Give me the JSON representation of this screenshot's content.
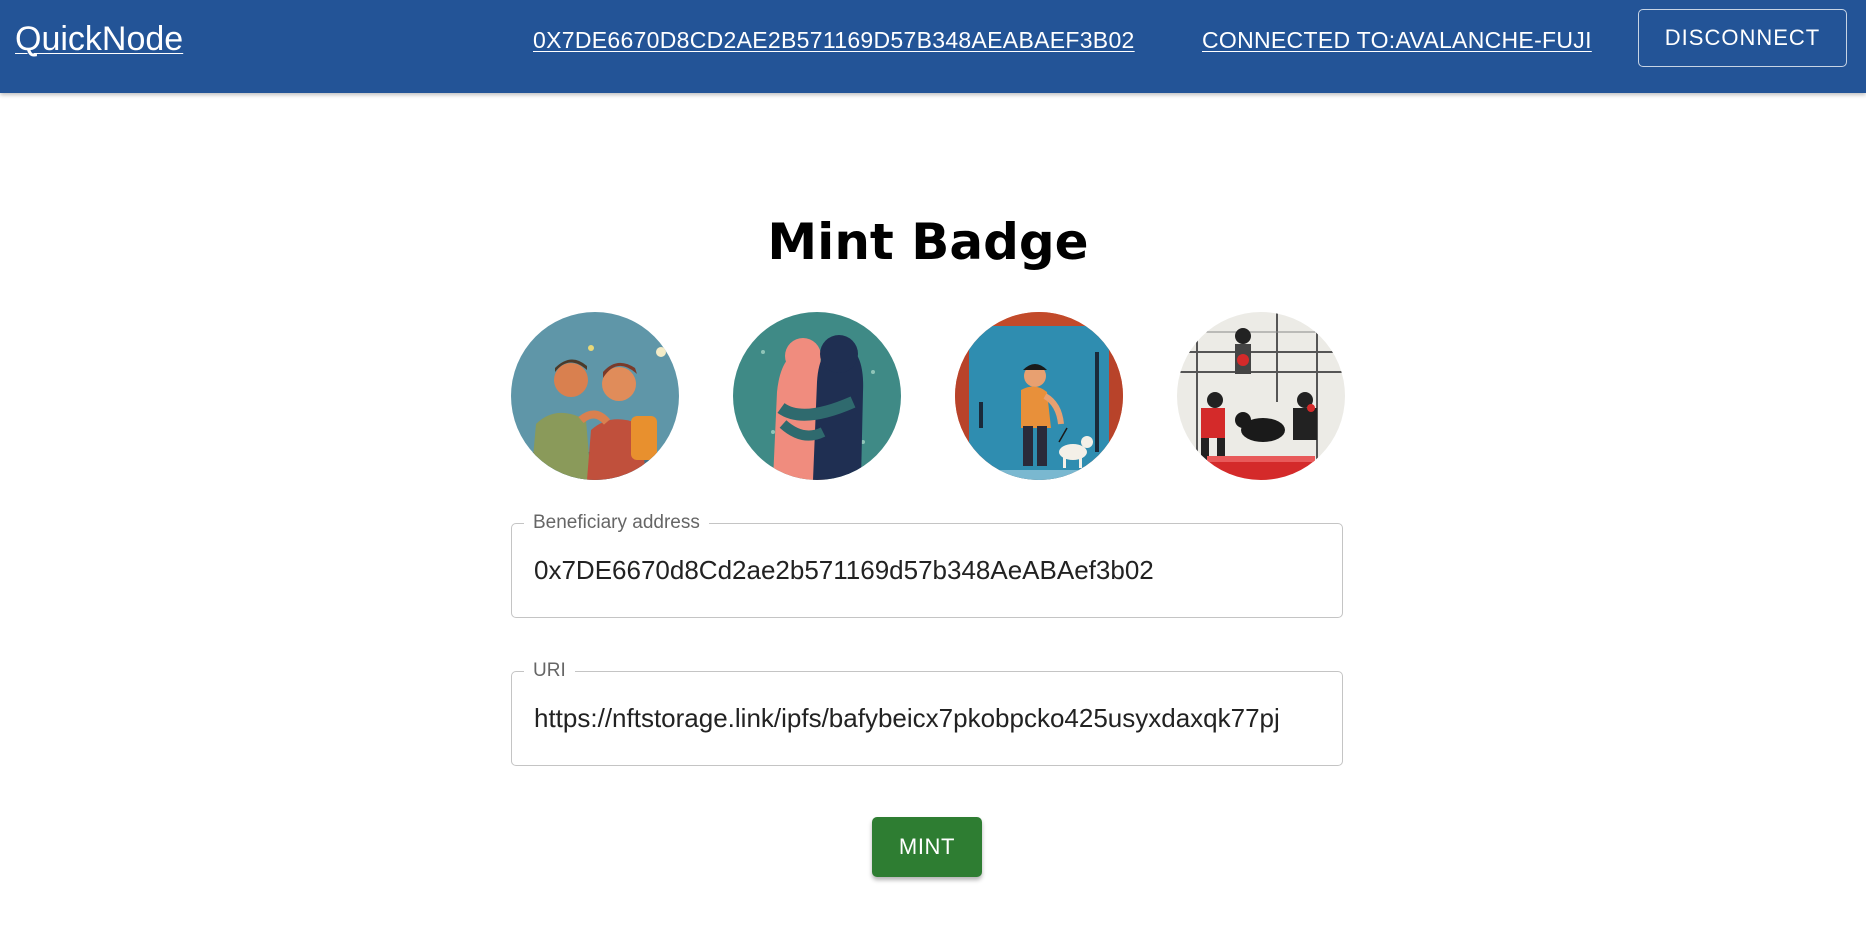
{
  "app": {
    "brand": "QuickNode"
  },
  "header": {
    "account_address": "0X7DE6670D8CD2AE2B571169D57B348AEABAEF3B02",
    "network_status": "CONNECTED TO:AVALANCHE-FUJI",
    "disconnect_label": "DISCONNECT"
  },
  "main": {
    "title": "Mint Badge",
    "badges": [
      {
        "icon": "badge-friends-image"
      },
      {
        "icon": "badge-hug-image"
      },
      {
        "icon": "badge-dog-walk-image"
      },
      {
        "icon": "badge-rescue-image"
      }
    ],
    "beneficiary": {
      "label": "Beneficiary address",
      "value": "0x7DE6670d8Cd2ae2b571169d57b348AeABAef3b02"
    },
    "uri": {
      "label": "URI",
      "value": "https://nftstorage.link/ipfs/bafybeicx7pkobpcko425usyxdaxqk77pj"
    },
    "mint_label": "MINT"
  },
  "colors": {
    "appbar": "#235497",
    "mint_button": "#2e7d32",
    "field_border": "#c4c4c4"
  }
}
